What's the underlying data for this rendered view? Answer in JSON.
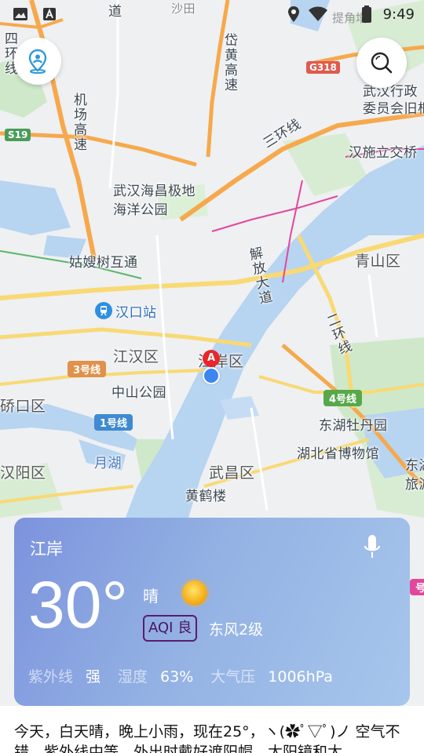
{
  "status_bar": {
    "time": "9:49",
    "carrier_text": "提角增"
  },
  "map": {
    "labels": {
      "top_road_a": "道",
      "top_shaho": "沙田",
      "left_ring": "四环线",
      "airport_expressway": "机场高速",
      "daihuang_expressway": "岱黄高速",
      "wuhan_admin": "武汉行政\n委员会旧枢",
      "third_ring": "三环线",
      "hanshi_interchange": "汉施立交桥",
      "haichang": "武汉海昌极地\n海洋公园",
      "gusao_interchange": "姑嫂树互通",
      "jiefang_road": "解放大道",
      "qingshan": "青山区",
      "hankou_station": "汉口站",
      "jianghan": "江汉区",
      "jiangan": "江岸区",
      "second_ring": "二环线",
      "zhongshan_park": "中山公园",
      "qiaokou": "硚口区",
      "donghu_peony": "东湖牡丹园",
      "hubei_museum": "湖北省博物馆",
      "donghu_tour": "东湖\n旅游",
      "yuehu": "月湖",
      "hanyang": "汉阳区",
      "wuchang": "武昌区",
      "yellow_crane": "黄鹤楼"
    },
    "road_badges": {
      "g318": "G318",
      "s19": "S19"
    },
    "metro_badges": {
      "line3": "3号线",
      "line4": "4号线",
      "line1": "1号线",
      "line_partial": "号"
    },
    "marker_letter": "A"
  },
  "weather": {
    "location": "江岸",
    "temperature": "30°",
    "condition": "晴",
    "aqi": "AQI 良",
    "wind": "东风2级",
    "uv_label": "紫外线",
    "uv_value": "强",
    "humidity_label": "湿度",
    "humidity_value": "63%",
    "pressure_label": "大气压",
    "pressure_value": "1006hPa"
  },
  "summary": "今天，白天晴，晚上小雨，现在25°，ヽ(✿ﾟ▽ﾟ)ノ 空气不错，紫外线中等，外出时戴好遮阳帽，太阳镜和太",
  "colors": {
    "water": "#b7d4f1",
    "green": "#cfe8c9",
    "road_orange": "#f6a94c",
    "road_yellow": "#f9d973",
    "metro_pink": "#e2479b",
    "card_start": "#7c93dd",
    "card_end": "#a7c6ec"
  }
}
